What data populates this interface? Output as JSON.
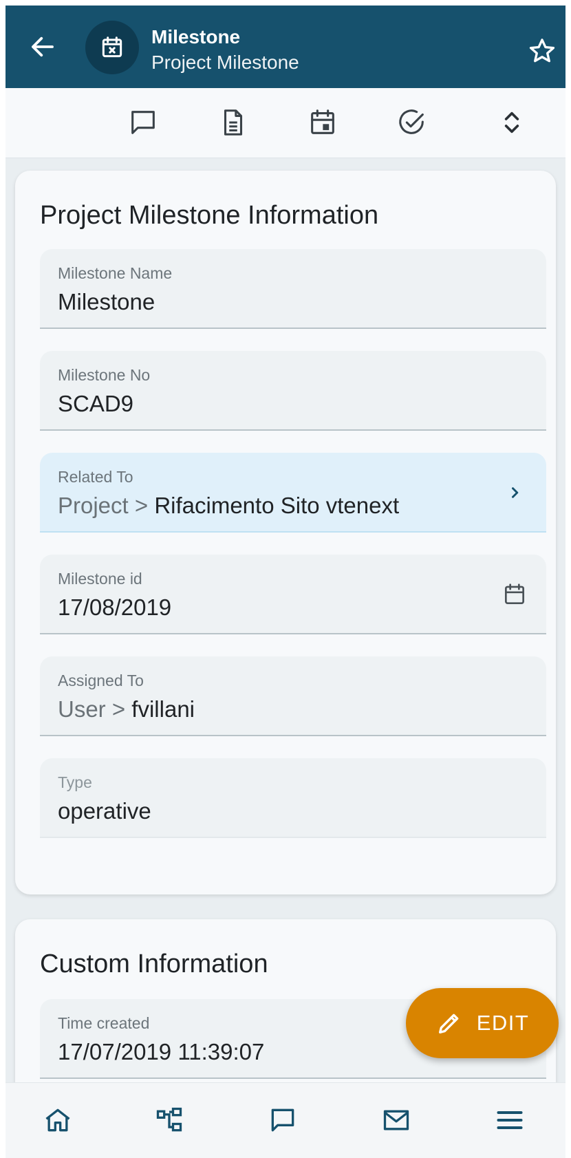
{
  "header": {
    "title": "Milestone",
    "subtitle": "Project Milestone",
    "back_icon": "arrow-left-icon",
    "module_icon": "calendar-x-icon",
    "favorite_icon": "star-outline-icon"
  },
  "toolbar": {
    "items": [
      "comment-icon",
      "document-icon",
      "calendar-icon",
      "check-circle-icon",
      "expand-collapse-icon"
    ]
  },
  "section_info": {
    "title": "Project Milestone Information",
    "fields": [
      {
        "label": "Milestone Name",
        "value": "Milestone"
      },
      {
        "label": "Milestone No",
        "value": "SCAD9"
      },
      {
        "label": "Related To",
        "prefix": "Project > ",
        "value": "Rifacimento Sito vtenext"
      },
      {
        "label": "Milestone id",
        "value": "17/08/2019"
      },
      {
        "label": "Assigned To",
        "prefix": "User > ",
        "value": "fvillani"
      },
      {
        "label": "Type",
        "value": "operative"
      }
    ]
  },
  "section_custom": {
    "title": "Custom Information",
    "fields": [
      {
        "label": "Time created",
        "value": "17/07/2019 11:39:07"
      }
    ]
  },
  "fab": {
    "label": "EDIT",
    "icon": "pencil-icon"
  },
  "bottom_nav": {
    "items": [
      "home-icon",
      "hierarchy-icon",
      "chat-icon",
      "mail-icon",
      "menu-icon"
    ]
  },
  "colors": {
    "header": "#16516d",
    "accent": "#d98400",
    "related_field": "#e0f0fa"
  }
}
